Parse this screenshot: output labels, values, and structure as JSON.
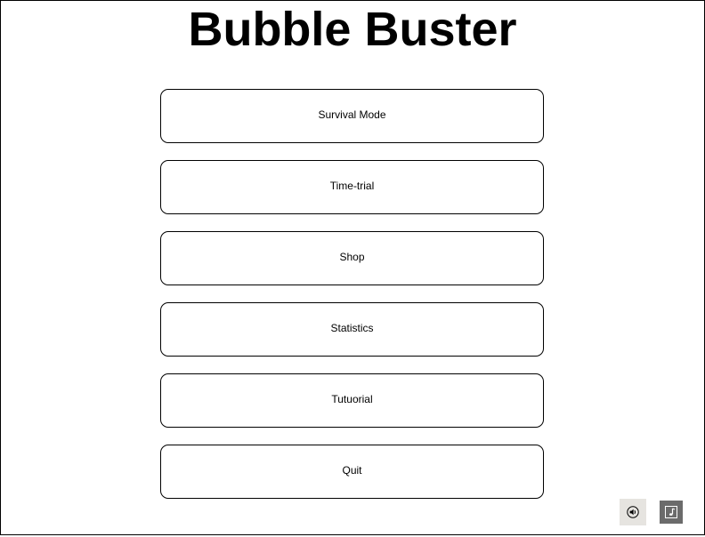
{
  "title": "Bubble Buster",
  "menu": {
    "buttons": [
      {
        "label": "Survival Mode"
      },
      {
        "label": "Time-trial"
      },
      {
        "label": "Shop"
      },
      {
        "label": "Statistics"
      },
      {
        "label": "Tutuorial"
      },
      {
        "label": "Quit"
      }
    ]
  },
  "controls": {
    "sound_icon": "speaker-icon",
    "music_icon": "music-toggle-icon"
  }
}
